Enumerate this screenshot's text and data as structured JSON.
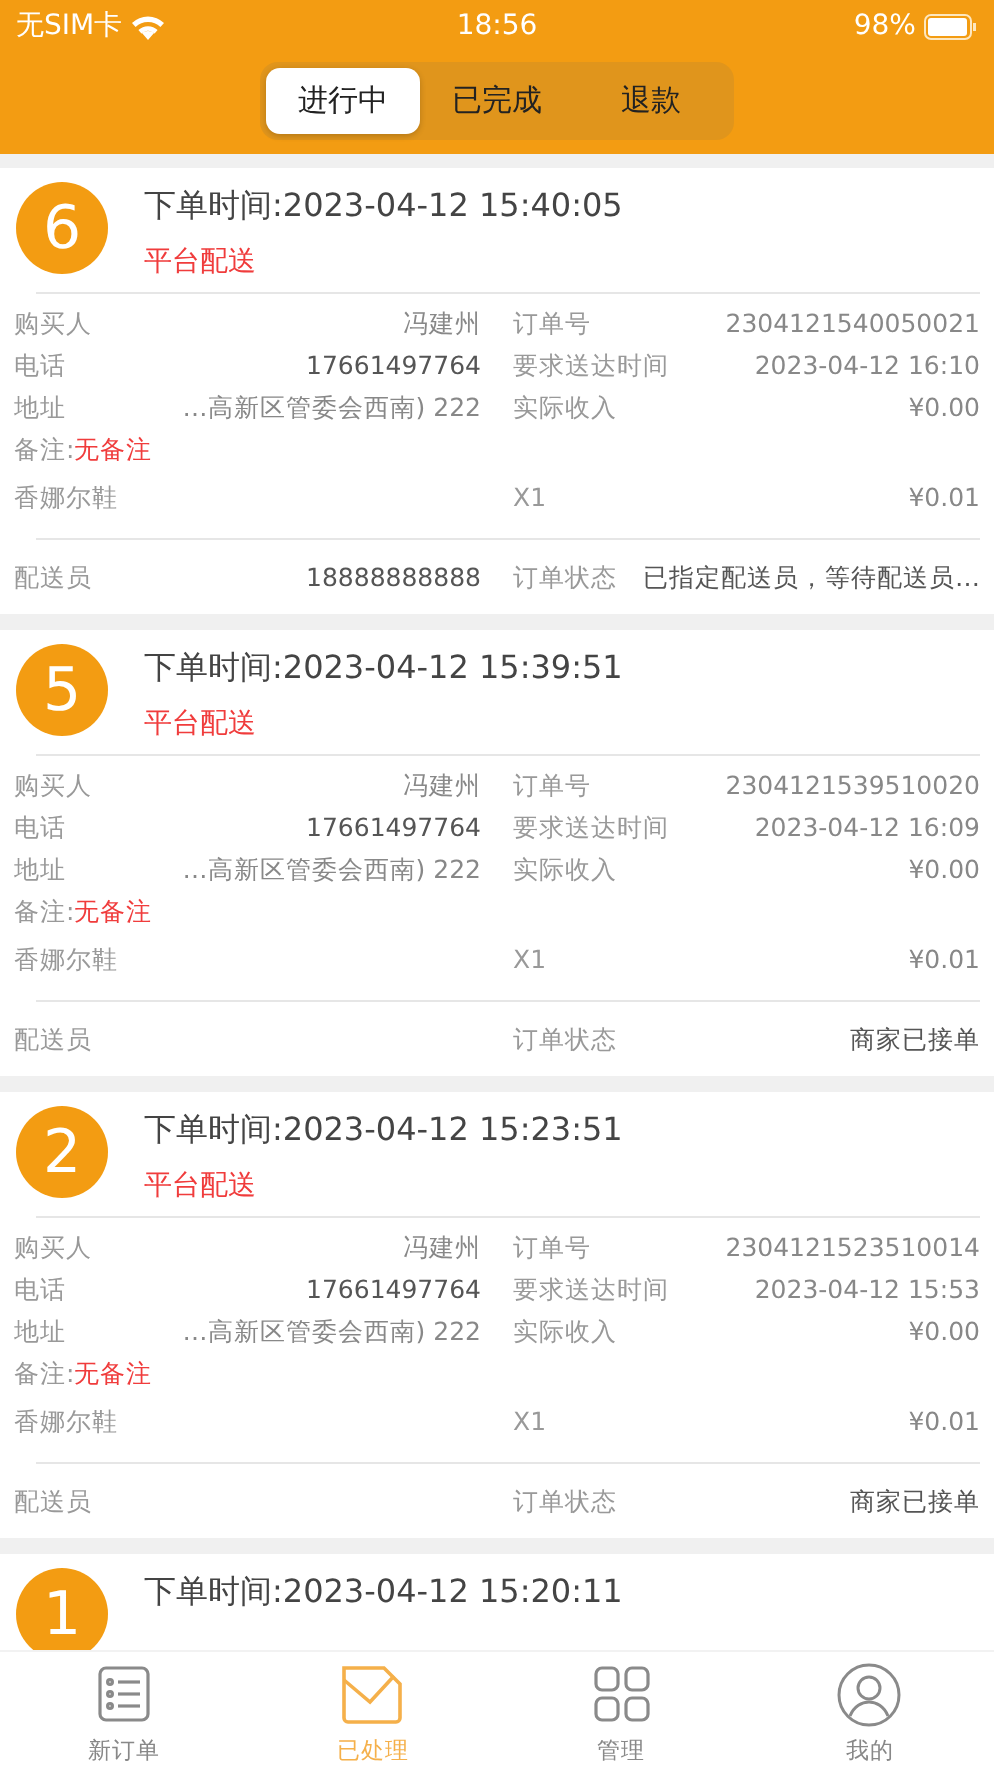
{
  "status_bar": {
    "carrier": "无SIM卡",
    "time": "18:56",
    "battery": "98%"
  },
  "segments": [
    {
      "label": "进行中",
      "selected": true
    },
    {
      "label": "已完成",
      "selected": false
    },
    {
      "label": "退款",
      "selected": false
    }
  ],
  "orders": [
    {
      "number": "6",
      "order_time": "下单时间:2023-04-12 15:40:05",
      "delivery": "平台配送",
      "rows": [
        {
          "left_label": "购买人",
          "left_value": "冯建州",
          "right_label": "订单号",
          "right_value": "2304121540050021"
        },
        {
          "left_label": "电话",
          "left_value": "17661497764",
          "right_label": "要求送达时间",
          "right_value": "2023-04-12 16:10"
        },
        {
          "left_label": "地址",
          "left_value": "…高新区管委会西南) 222",
          "right_label": "实际收入",
          "right_value": "¥0.00"
        }
      ],
      "remark_label": "备注:",
      "remark": "无备注",
      "product": {
        "name": "香娜尔鞋",
        "qty": "X1",
        "price": "¥0.01"
      },
      "courier_label": "配送员",
      "courier": "18888888888",
      "status_label": "订单状态",
      "status": "已指定配送员，等待配送员…"
    },
    {
      "number": "5",
      "order_time": "下单时间:2023-04-12 15:39:51",
      "delivery": "平台配送",
      "rows": [
        {
          "left_label": "购买人",
          "left_value": "冯建州",
          "right_label": "订单号",
          "right_value": "2304121539510020"
        },
        {
          "left_label": "电话",
          "left_value": "17661497764",
          "right_label": "要求送达时间",
          "right_value": "2023-04-12 16:09"
        },
        {
          "left_label": "地址",
          "left_value": "…高新区管委会西南) 222",
          "right_label": "实际收入",
          "right_value": "¥0.00"
        }
      ],
      "remark_label": "备注:",
      "remark": "无备注",
      "product": {
        "name": "香娜尔鞋",
        "qty": "X1",
        "price": "¥0.01"
      },
      "courier_label": "配送员",
      "status_label": "订单状态",
      "status": "商家已接单"
    },
    {
      "number": "2",
      "order_time": "下单时间:2023-04-12 15:23:51",
      "delivery": "平台配送",
      "rows": [
        {
          "left_label": "购买人",
          "left_value": "冯建州",
          "right_label": "订单号",
          "right_value": "2304121523510014"
        },
        {
          "left_label": "电话",
          "left_value": "17661497764",
          "right_label": "要求送达时间",
          "right_value": "2023-04-12 15:53"
        },
        {
          "left_label": "地址",
          "left_value": "…高新区管委会西南) 222",
          "right_label": "实际收入",
          "right_value": "¥0.00"
        }
      ],
      "remark_label": "备注:",
      "remark": "无备注",
      "product": {
        "name": "香娜尔鞋",
        "qty": "X1",
        "price": "¥0.01"
      },
      "courier_label": "配送员",
      "status_label": "订单状态",
      "status": "商家已接单"
    },
    {
      "number": "1",
      "order_time": "下单时间:2023-04-12 15:20:11"
    }
  ],
  "tab_bar": [
    {
      "kind": "list",
      "label": "新订单",
      "selected": false
    },
    {
      "kind": "mail",
      "label": "已处理",
      "selected": true
    },
    {
      "kind": "grid",
      "label": "管理",
      "selected": false
    },
    {
      "kind": "user",
      "label": "我的",
      "selected": false
    }
  ]
}
